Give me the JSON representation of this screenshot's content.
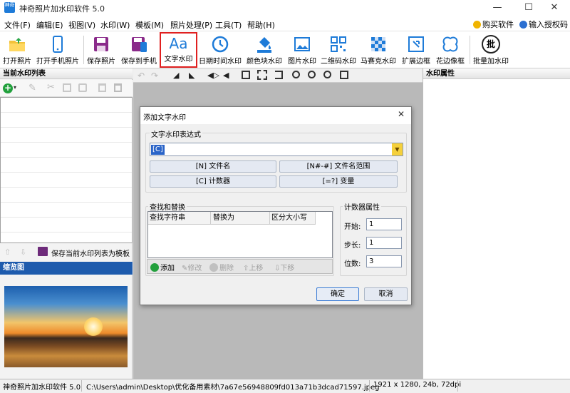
{
  "window": {
    "title": "神奇照片加水印软件 5.0",
    "icon_text": "神奇"
  },
  "menu": [
    "文件(F)",
    "编辑(E)",
    "视图(V)",
    "水印(W)",
    "模板(M)",
    "照片处理(P)",
    "工具(T)",
    "帮助(H)"
  ],
  "menu_right": {
    "buy": "购买软件",
    "register": "输入授权码"
  },
  "toolbar": [
    {
      "label": "打开照片",
      "icon": "folder-icon"
    },
    {
      "label": "打开手机照片",
      "icon": "phone-icon"
    },
    {
      "label": "保存照片",
      "icon": "save-icon"
    },
    {
      "label": "保存到手机",
      "icon": "save-phone-icon"
    },
    {
      "label": "文字水印",
      "icon": "text-aa-icon"
    },
    {
      "label": "日期时间水印",
      "icon": "clock-icon"
    },
    {
      "label": "颜色块水印",
      "icon": "paint-bucket-icon"
    },
    {
      "label": "图片水印",
      "icon": "image-icon"
    },
    {
      "label": "二维码水印",
      "icon": "qrcode-icon"
    },
    {
      "label": "马赛克水印",
      "icon": "mosaic-icon"
    },
    {
      "label": "扩展边框",
      "icon": "expand-border-icon"
    },
    {
      "label": "花边像框",
      "icon": "flower-frame-icon"
    },
    {
      "label": "批量加水印",
      "icon": "batch-icon"
    }
  ],
  "toolbar_batch_glyph": "批",
  "left_panel": {
    "title": "当前水印列表",
    "save_template": "保存当前水印列表为模板",
    "preview_title": "缩览图"
  },
  "right_panel": {
    "title": "水印属性"
  },
  "status": {
    "app": "神奇照片加水印软件 5.0",
    "path": "C:\\Users\\admin\\Desktop\\优化备用素材\\7a67e56948809fd013a71b3dcad71597.jpeg",
    "info": "1921 x 1280, 24b, 72dpi"
  },
  "dialog": {
    "title": "添加文字水印",
    "expr_group": "文字水印表达式",
    "expr_value": "[C]",
    "btn_filename": "[N] 文件名",
    "btn_filename_range": "[N#-#] 文件名范围",
    "btn_counter": "[C] 计数器",
    "btn_variable": "[=?] 变量",
    "find_group": "查找和替换",
    "columns": [
      "查找字符串",
      "替换为",
      "区分大小写"
    ],
    "actions": {
      "add": "添加",
      "edit": "修改",
      "delete": "删除",
      "up": "上移",
      "down": "下移"
    },
    "counter_group": "计数器属性",
    "start_label": "开始:",
    "start_value": "1",
    "step_label": "步长:",
    "step_value": "1",
    "digits_label": "位数:",
    "digits_value": "3",
    "ok": "确定",
    "cancel": "取消"
  },
  "colors": {
    "accent": "#1e7bd8",
    "selected_border": "#e02020",
    "preview_header": "#1e5bad"
  }
}
